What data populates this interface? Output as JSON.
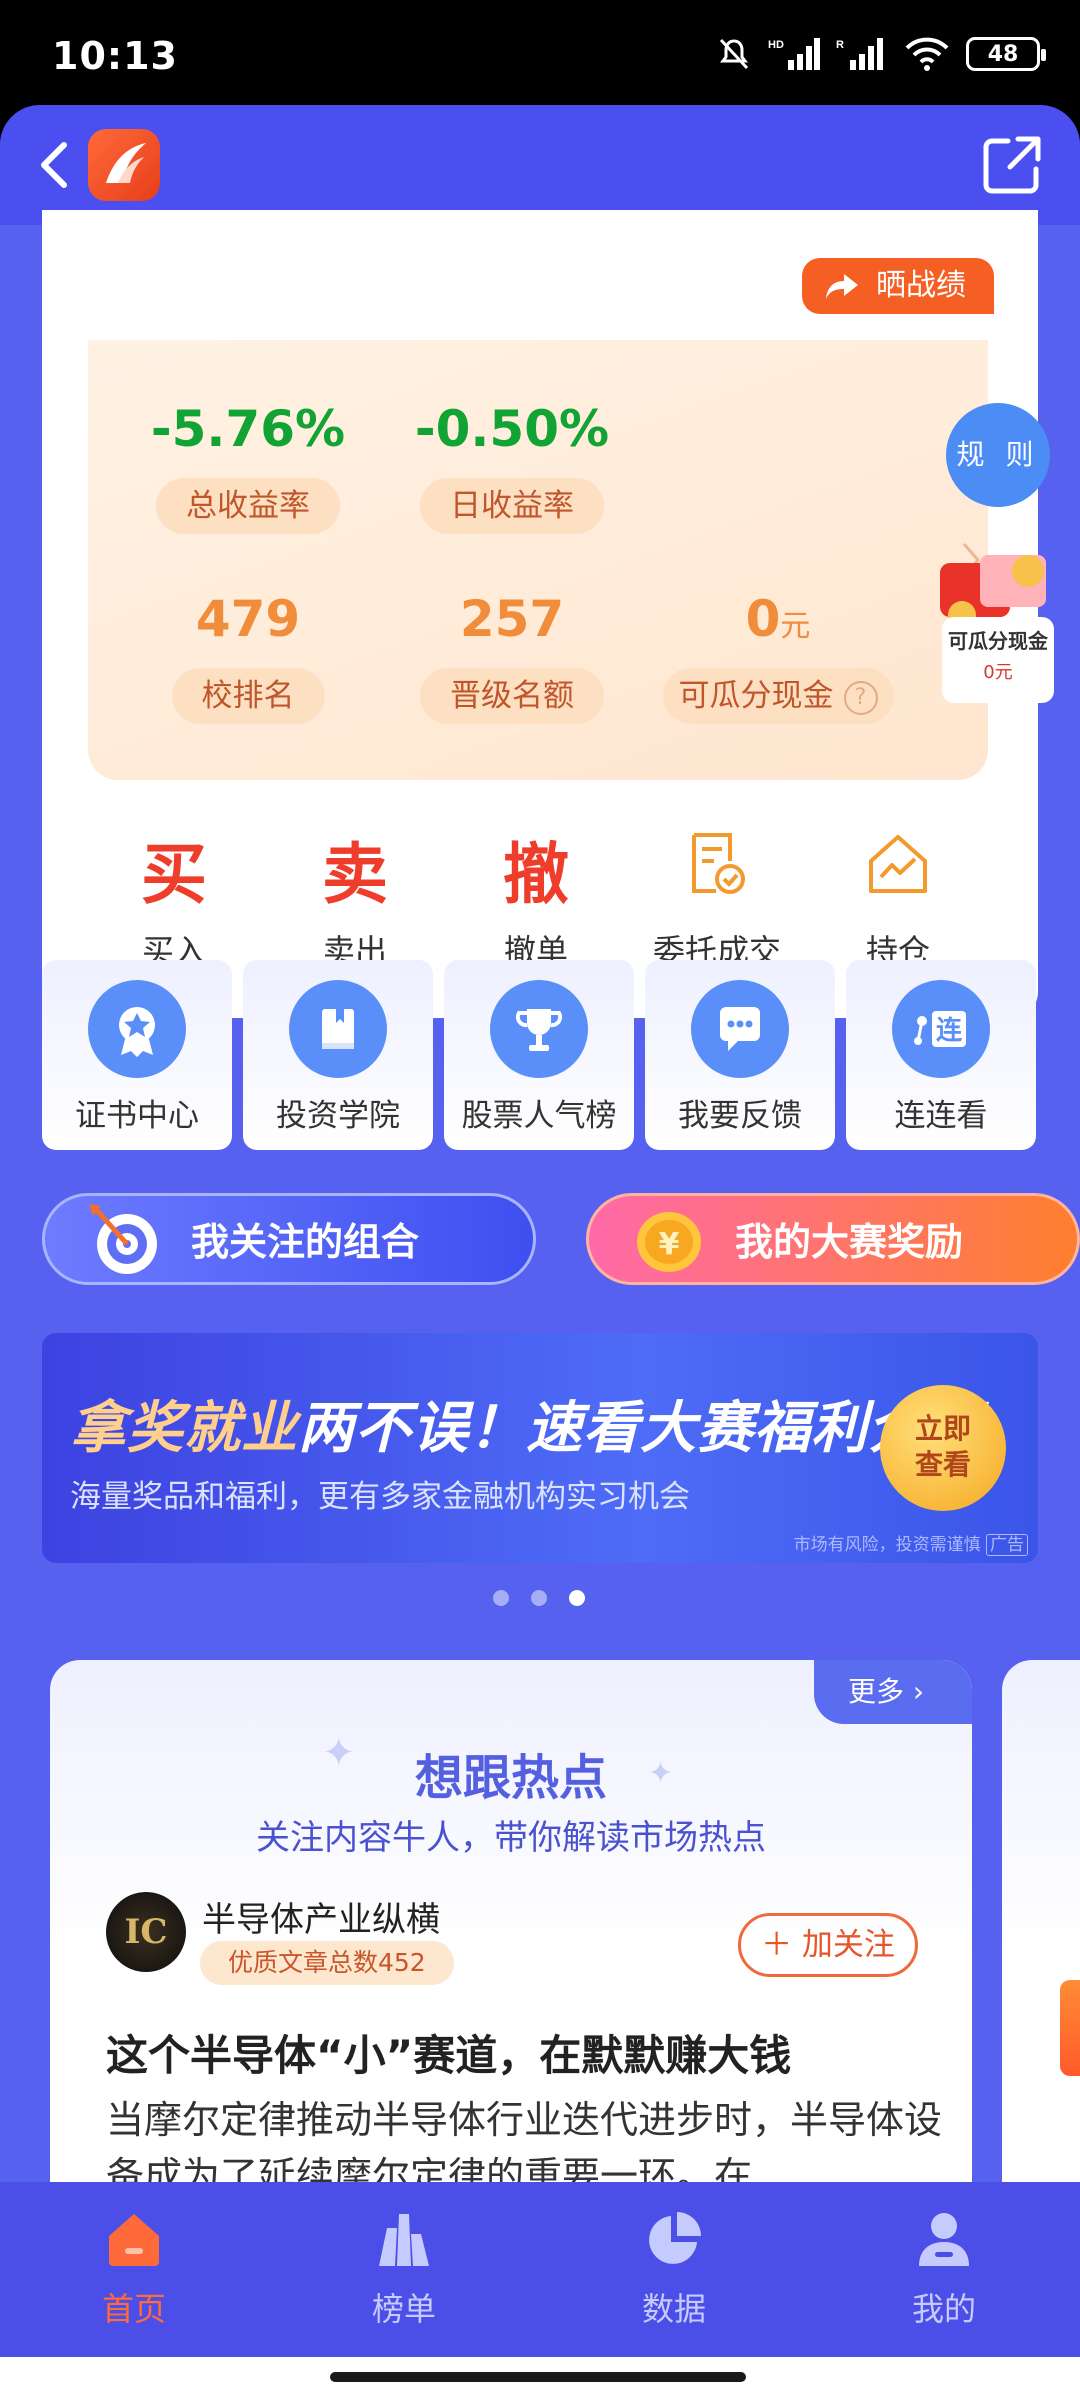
{
  "status_bar": {
    "time": "10:13",
    "battery": "48"
  },
  "stats": {
    "share_label": "晒战绩",
    "total_return": {
      "value": "-5.76%",
      "label": "总收益率"
    },
    "daily_return": {
      "value": "-0.50%",
      "label": "日收益率"
    },
    "school_rank": {
      "value": "479",
      "label": "校排名"
    },
    "promotion_quota": {
      "value": "257",
      "label": "晋级名额"
    },
    "cash": {
      "value": "0",
      "unit": "元",
      "label": "可瓜分现金",
      "help": "?"
    }
  },
  "rule_label": "规 则",
  "cash_float": {
    "title": "可瓜分现金",
    "amount": "0元"
  },
  "actions": [
    {
      "glyph": "买",
      "label": "买入"
    },
    {
      "glyph": "卖",
      "label": "卖出"
    },
    {
      "glyph": "撤",
      "label": "撤单"
    },
    {
      "glyph": "",
      "label": "委托成交",
      "icon": "document-check-icon"
    },
    {
      "glyph": "",
      "label": "持仓",
      "icon": "chart-house-icon"
    }
  ],
  "tiles": [
    {
      "label": "证书中心",
      "icon": "certificate-icon"
    },
    {
      "label": "投资学院",
      "icon": "book-icon"
    },
    {
      "label": "股票人气榜",
      "icon": "trophy-icon"
    },
    {
      "label": "我要反馈",
      "icon": "chat-icon"
    },
    {
      "label": "连连看",
      "icon": "connect-icon"
    }
  ],
  "buttons": {
    "follow": "我关注的组合",
    "award": "我的大赛奖励"
  },
  "banner": {
    "title_highlight": "拿奖就业",
    "title_rest": "两不误！速看大赛福利介绍",
    "subtitle": "海量奖品和福利，更有多家金融机构实习机会",
    "cta_line1": "立即",
    "cta_line2": "查看",
    "risk": "市场有风险，投资需谨慎",
    "ad": "广告"
  },
  "hot": {
    "more": "更多",
    "title": "想跟热点",
    "subtitle": "关注内容牛人，带你解读市场热点",
    "avatar_text": "IC",
    "author": "半导体产业纵横",
    "author_tag": "优质文章总数452",
    "follow": "加关注",
    "article_title": "这个半导体“小”赛道，在默默赚大钱",
    "article_body": "当摩尔定律推动半导体行业迭代进步时，半导体设备成为了延续摩尔定律的重要一环。在…"
  },
  "nav": [
    {
      "label": "首页",
      "icon": "home-icon",
      "active": true
    },
    {
      "label": "榜单",
      "icon": "ranking-icon",
      "active": false
    },
    {
      "label": "数据",
      "icon": "pie-chart-icon",
      "active": false
    },
    {
      "label": "我的",
      "icon": "profile-icon",
      "active": false
    }
  ],
  "colors": {
    "accent": "#5661f0",
    "orange": "#f55f24",
    "green": "#12a335",
    "red": "#ef3d2c"
  }
}
